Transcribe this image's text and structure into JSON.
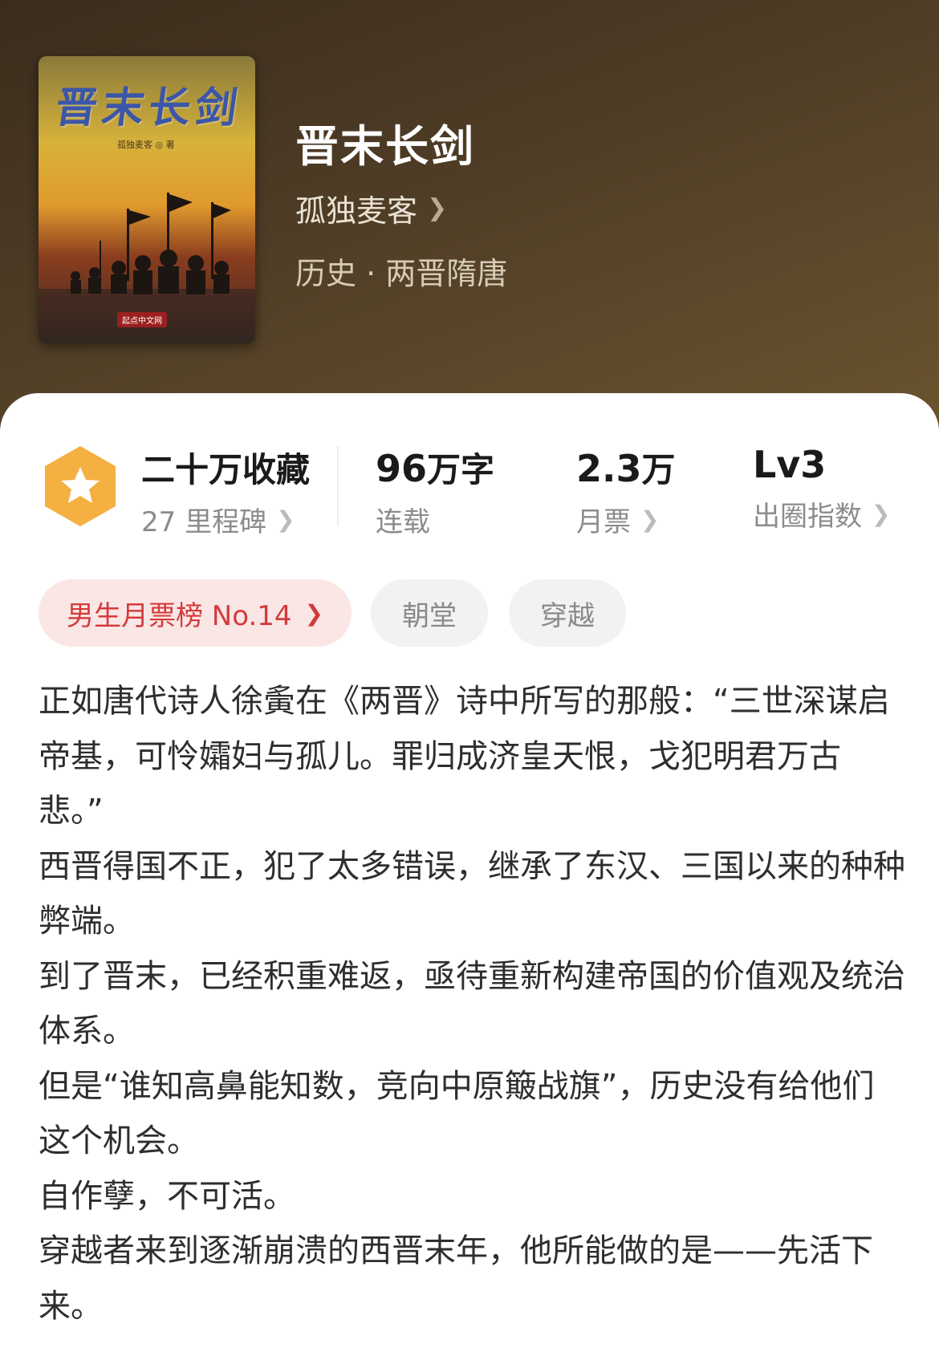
{
  "book": {
    "cover_title": "晋末长剑",
    "cover_author": "孤独麦客 ◎ 著",
    "cover_publisher": "起点中文网",
    "title": "晋末长剑",
    "author": "孤独麦客",
    "genre": "历史 · 两晋隋唐"
  },
  "stats": {
    "favorites": "二十万收藏",
    "milestones": "27 里程碑",
    "word_count_num": "96",
    "word_count_unit": "万字",
    "status": "连载",
    "monthly_votes_num": "2.3",
    "monthly_votes_unit": "万",
    "monthly_votes_label": "月票",
    "level": "Lv3",
    "level_label": "出圈指数"
  },
  "chips": {
    "rank": "男生月票榜 No.14",
    "tags": [
      "朝堂",
      "穿越"
    ]
  },
  "description": [
    "正如唐代诗人徐夤在《两晋》诗中所写的那般：“三世深谋启帝基，可怜孀妇与孤儿。罪归成济皇天恨，戈犯明君万古悲。”",
    "西晋得国不正，犯了太多错误，继承了东汉、三国以来的种种弊端。",
    "到了晋末，已经积重难返，亟待重新构建帝国的价值观及统治体系。",
    "但是“谁知高鼻能知数，竞向中原簸战旗”，历史没有给他们这个机会。",
    "自作孽，不可活。",
    "穿越者来到逐渐崩溃的西晋末年，他所能做的是——先活下来。"
  ],
  "colors": {
    "hero_bg": "#4f3d26",
    "badge": "#f5b042",
    "rank_chip_bg": "#fbe6e6",
    "rank_chip_text": "#d33b3b"
  },
  "icons": [
    "star-badge-icon",
    "chevron-right-icon"
  ]
}
